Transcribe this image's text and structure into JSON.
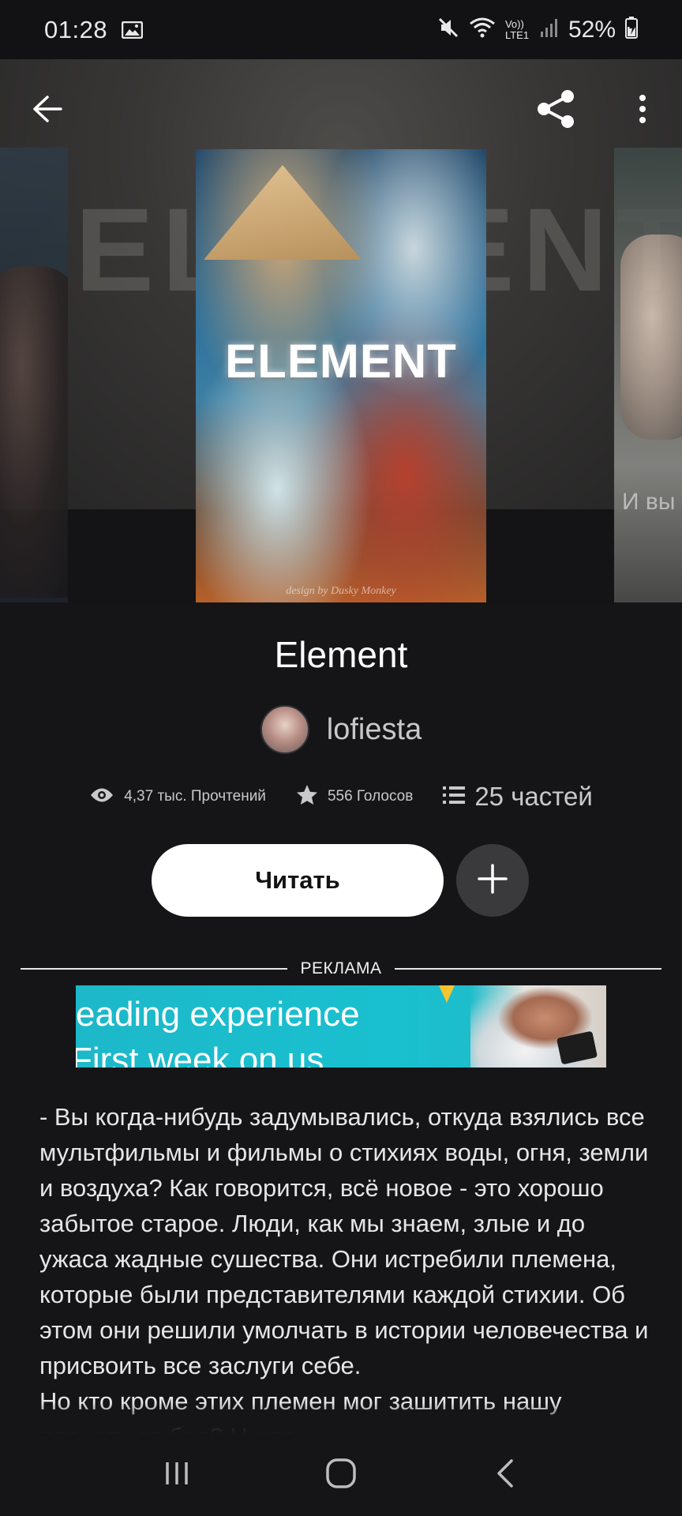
{
  "status_bar": {
    "time": "01:28",
    "battery": "52%",
    "icons": [
      "image-icon",
      "mute-icon",
      "wifi-icon",
      "volte-lte-icon",
      "signal-icon",
      "battery-charging-icon"
    ],
    "volte_label": "Vo)) LTE1"
  },
  "toolbar": {
    "back_icon": "arrow-left-icon",
    "share_icon": "share-icon",
    "more_icon": "more-vertical-icon"
  },
  "covers": {
    "main_title": "ELEMENT",
    "main_credit": "design by Dusky Monkey",
    "background_text": "ELEMENT",
    "right_peek_text": "И вы"
  },
  "story": {
    "title": "Element",
    "author": "lofiesta"
  },
  "stats": {
    "reads": "4,37 тыс. Прочтений",
    "votes": "556 Голосов",
    "parts": "25 частей"
  },
  "actions": {
    "read_label": "Читать",
    "add_label": "+"
  },
  "ad": {
    "label": "РЕКЛАМА",
    "line1": "eading experience",
    "line2": "First week on us."
  },
  "description": {
    "paragraphs": [
      "- Вы когда-нибудь задумывались, откуда взялись все мультфильмы и фильмы о стихиях воды, огня, земли и воздуха? Как говорится, всё новое - это хорошо забытое старое. Люди, как мы знаем, злые и до ужаса жадные сушества. Они истребили племена, которые были представителями каждой стихии. Об этом они решили умолчать в истории человечества и присвоить все заслуги себе.",
      "Но кто кроме этих племен мог зашитить нашу планету от бед? Никто..."
    ]
  },
  "nav_bar": {
    "recents_icon": "recents-icon",
    "home_icon": "home-icon",
    "back_icon": "nav-back-icon"
  },
  "colors": {
    "background": "#151518",
    "read_button": "#ffffff",
    "add_button": "#3a3a3d",
    "ad_banner": "#19c0cf",
    "text_secondary": "#c9c9c9"
  }
}
